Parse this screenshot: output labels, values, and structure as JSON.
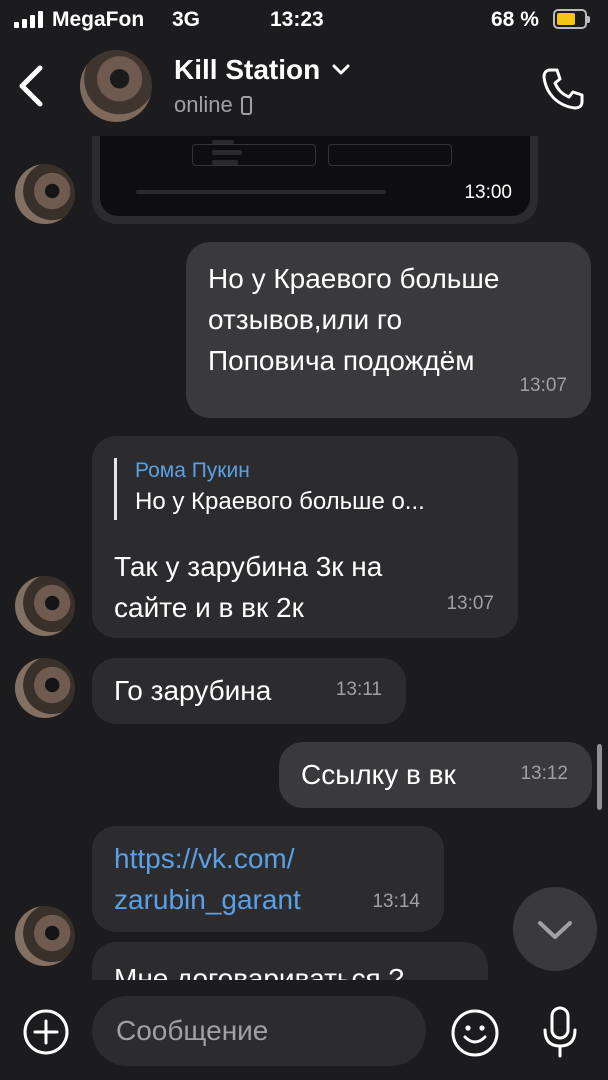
{
  "status_bar": {
    "carrier": "MegaFon",
    "network": "3G",
    "time": "13:23",
    "battery": "68 %",
    "battery_level": 0.68
  },
  "header": {
    "title": "Kill Station",
    "status": "online",
    "icons": [
      "back-chevron-icon",
      "chevron-down-icon",
      "phone-icon"
    ]
  },
  "messages": [
    {
      "type": "photo",
      "time": "13:00"
    },
    {
      "type": "outgoing",
      "lines": [
        "Но у Краевого больше",
        "отзывов,или го",
        "Поповича подождём"
      ],
      "time": "13:07"
    },
    {
      "type": "incoming",
      "reply": {
        "name": "Рома Пукин",
        "text": "Но у Краевого больше о..."
      },
      "lines": [
        "Так у зарубина 3к на",
        "сайте и в вк 2к"
      ],
      "time": "13:07"
    },
    {
      "type": "incoming",
      "lines": [
        "Го зарубина"
      ],
      "time": "13:11"
    },
    {
      "type": "outgoing",
      "lines": [
        "Ссылку в вк"
      ],
      "time": "13:12"
    },
    {
      "type": "incoming",
      "lines": [
        "https://vk.com/",
        "zarubin_garant"
      ],
      "time": "13:14",
      "is_link": true
    },
    {
      "type": "incoming",
      "lines": [
        "Мне договариваться ?"
      ],
      "partial": true
    }
  ],
  "input": {
    "placeholder": "Сообщение",
    "icons": [
      "plus-circle-icon",
      "emoji-icon",
      "microphone-icon"
    ]
  },
  "colors": {
    "background": "#1c1c1e",
    "incoming_bubble": "#2c2c2e",
    "outgoing_bubble": "#3a3a3c",
    "link": "#5aa0e6",
    "battery": "#f5c518"
  }
}
